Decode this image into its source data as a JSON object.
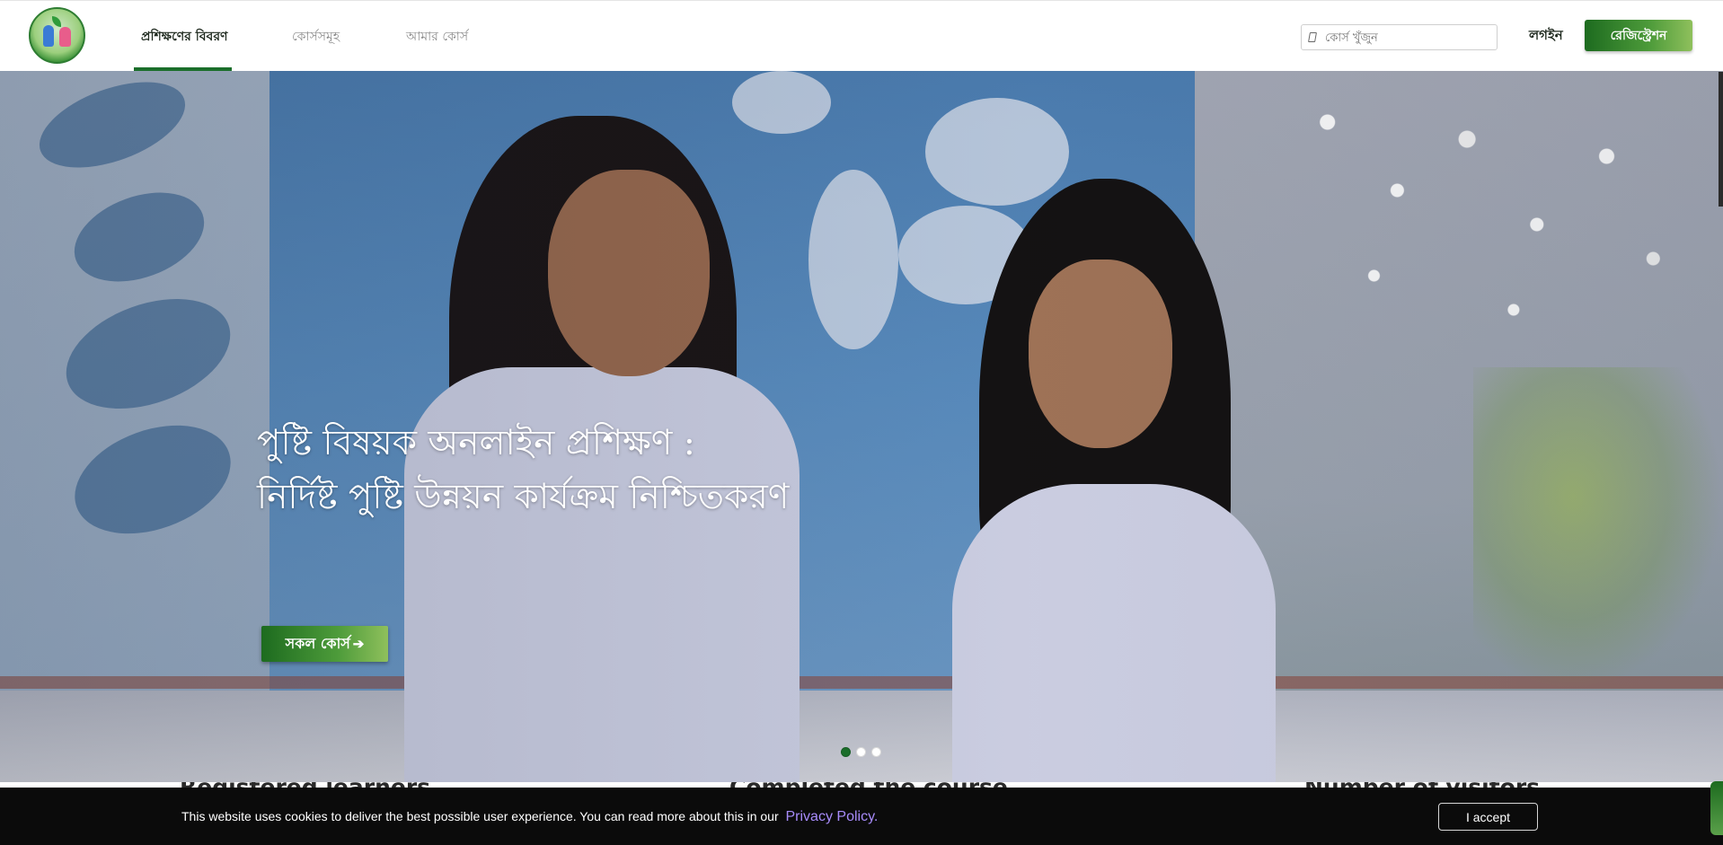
{
  "header": {
    "logo_alt": "logo",
    "nav": [
      {
        "label": "প্রশিক্ষণের বিবরণ",
        "active": true
      },
      {
        "label": "কোর্সসমূহ",
        "active": false
      },
      {
        "label": "আমার কোর্স",
        "active": false
      }
    ],
    "search": {
      "placeholder": "কোর্স খুঁজুন"
    },
    "login_label": "লগইন",
    "register_label": "রেজিস্ট্রেশন"
  },
  "hero": {
    "title_line1": "পুষ্টি বিষয়ক অনলাইন প্রশিক্ষণ :",
    "title_line2": "নির্দিষ্ট পুষ্টি উন্নয়ন কার্যক্রম নিশ্চিতকরণ",
    "cta_label": "সকল কোর্স",
    "cta_icon": "arrow-right-icon",
    "slides": 3,
    "active_slide": 1
  },
  "stats": {
    "labels": [
      "Registered learners",
      "Completed the course",
      "Number of visitors"
    ]
  },
  "cookie": {
    "text": "This website uses cookies to deliver the best possible user experience. You can read more about this in our",
    "link_label": "Privacy Policy.",
    "accept_label": "I accept"
  },
  "colors": {
    "brand_green": "#1b6e2b",
    "button_gradient_start": "#1d6b1f",
    "button_gradient_end": "#8fc05c",
    "cookie_bg": "#0b0b0b",
    "link_purple": "#a78bfa"
  }
}
